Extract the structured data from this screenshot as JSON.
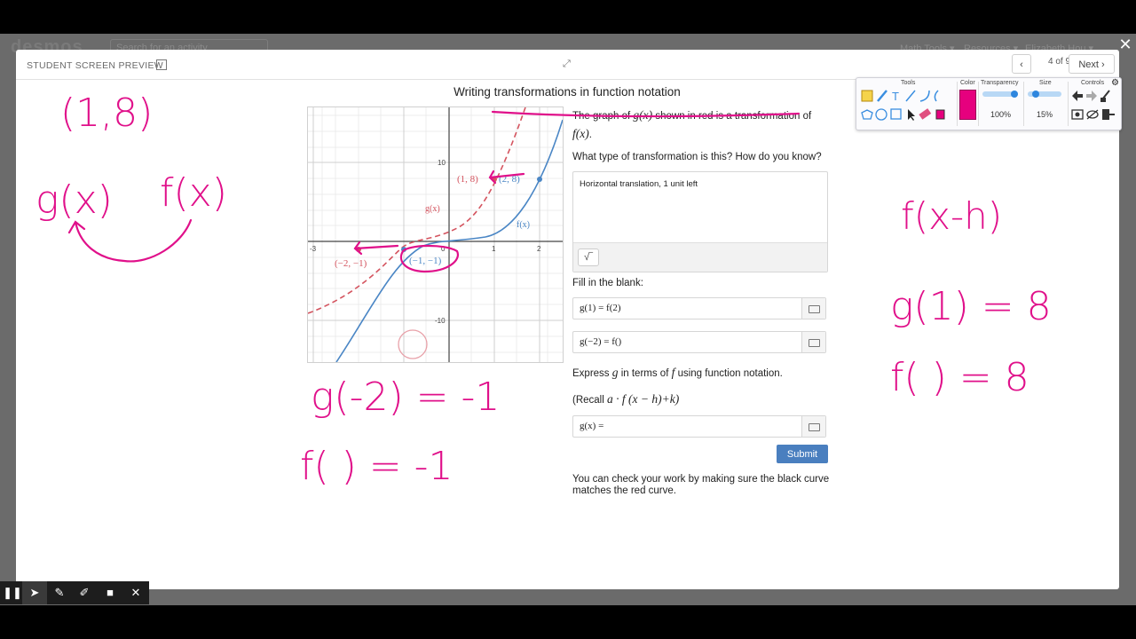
{
  "background": {
    "logo": "desmos",
    "search_placeholder": "Search for an activity",
    "nav": [
      "Math Tools ▾",
      "Resources ▾",
      "Elizabeth Hou ▾"
    ]
  },
  "preview": {
    "label": "STUDENT SCREEN PREVIEW",
    "page_count": "4 of 9",
    "next_label": "Next"
  },
  "activity": {
    "title": "Writing transformations in function notation",
    "graph_labels": {
      "gx": "g(x)",
      "fx": "f(x)",
      "tick_x_neg3": "-3",
      "tick_x_1": "1",
      "tick_x_2": "2",
      "tick_y_10": "10",
      "tick_y_neg10": "-10",
      "tick_origin": "0",
      "point_1_8": "(1, 8)",
      "point_2_8": "(2, 8)",
      "point_neg2_neg1": "(−2, −1)",
      "point_neg1_neg1": "(−1, −1)"
    },
    "q1_text_a": "The graph of",
    "q1_math_g": "g(x)",
    "q1_text_b": "shown in red is a",
    "q1_text_c": "transformation",
    "q1_text_d": "of",
    "q1_math_f": "f(x)",
    "q1_period": ".",
    "q2": "What type of transformation is this? How do you know?",
    "q2_answer": "Horizontal translation, 1 unit left",
    "sqrt_button": "√‾",
    "q3": "Fill in the blank:",
    "field1": "g(1) = f(2)",
    "field2": "g(−2) = f()",
    "q4_a": "Express",
    "q4_g": "g",
    "q4_b": "in terms of",
    "q4_f": "f",
    "q4_c": "using function notation.",
    "recall_prefix": "(Recall",
    "recall_expr": "a · f (x − h)+k)",
    "field3": "g(x) =",
    "submit": "Submit",
    "check_text": "You can check your work by making sure the black curve matches the red curve."
  },
  "sketch_toolbar": {
    "tools_label": "Tools",
    "color_label": "Color",
    "transparency_label": "Transparency",
    "size_label": "Size",
    "controls_label": "Controls",
    "transparency_value": "100%",
    "size_value": "15%",
    "transparency_level": 1.0,
    "size_level": 0.15,
    "pen_color": "#e6007e"
  },
  "handwriting": [
    "(1,8)",
    "g(x)",
    "f(x)",
    "f(x-h)",
    "g(1) = 8",
    "f( ) = 8",
    "g(-2) = -1",
    "f( ) = -1"
  ],
  "colors": {
    "g_curve": "#d4545f",
    "f_curve": "#4a86c5",
    "ink": "#e0108a",
    "submit": "#4a7fbf"
  }
}
